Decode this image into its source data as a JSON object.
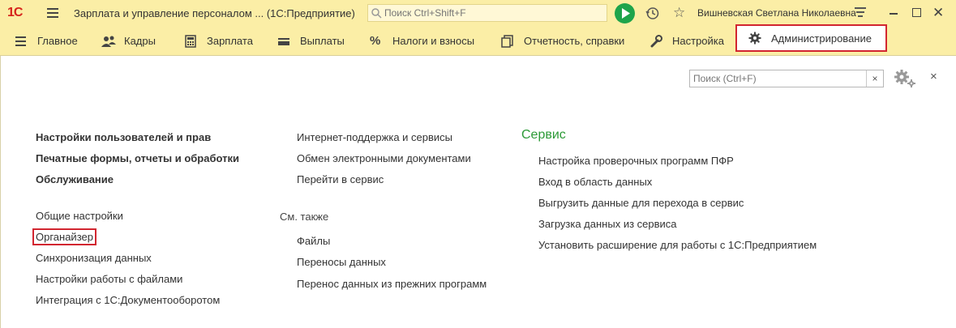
{
  "titlebar": {
    "logo": "1С",
    "title": "Зарплата и управление персоналом ...  (1С:Предприятие)",
    "search_placeholder": "Поиск Ctrl+Shift+F",
    "user": "Вишневская Светлана Николаевна"
  },
  "menu": {
    "items": [
      {
        "label": "Главное",
        "icon": "hamburger-icon"
      },
      {
        "label": "Кадры",
        "icon": "people-icon"
      },
      {
        "label": "Зарплата",
        "icon": "calculator-icon"
      },
      {
        "label": "Выплаты",
        "icon": "wallet-icon"
      },
      {
        "label": "Налоги и взносы",
        "icon": "percent-icon"
      },
      {
        "label": "Отчетность, справки",
        "icon": "documents-icon"
      },
      {
        "label": "Настройка",
        "icon": "wrench-icon"
      },
      {
        "label": "Администрирование",
        "icon": "gear-icon",
        "active": true
      }
    ]
  },
  "content": {
    "search_placeholder": "Поиск (Ctrl+F)",
    "clear_label": "×",
    "close_label": "×",
    "col1": {
      "bold": [
        "Настройки пользователей и прав",
        "Печатные формы, отчеты и обработки",
        "Обслуживание"
      ],
      "links": [
        "Общие настройки",
        "Органайзер",
        "Синхронизация данных",
        "Настройки работы с файлами",
        "Интеграция с 1С:Документооборотом"
      ]
    },
    "col2": {
      "links": [
        "Интернет-поддержка и сервисы",
        "Обмен электронными документами",
        "Перейти в сервис"
      ],
      "see_also_title": "См. также",
      "see_also": [
        "Файлы",
        "Переносы данных",
        "Перенос данных из прежних программ"
      ]
    },
    "col3": {
      "title": "Сервис",
      "links": [
        "Настройка проверочных программ ПФР",
        "Вход в область данных",
        "Выгрузить данные для перехода в сервис",
        "Загрузка данных из сервиса",
        "Установить расширение для работы с 1С:Предприятием"
      ]
    }
  },
  "colors": {
    "accent_red": "#d22630",
    "service_green": "#2c9a37",
    "toolbar_yellow": "#fbeea6",
    "play_green": "#1ea44b"
  }
}
